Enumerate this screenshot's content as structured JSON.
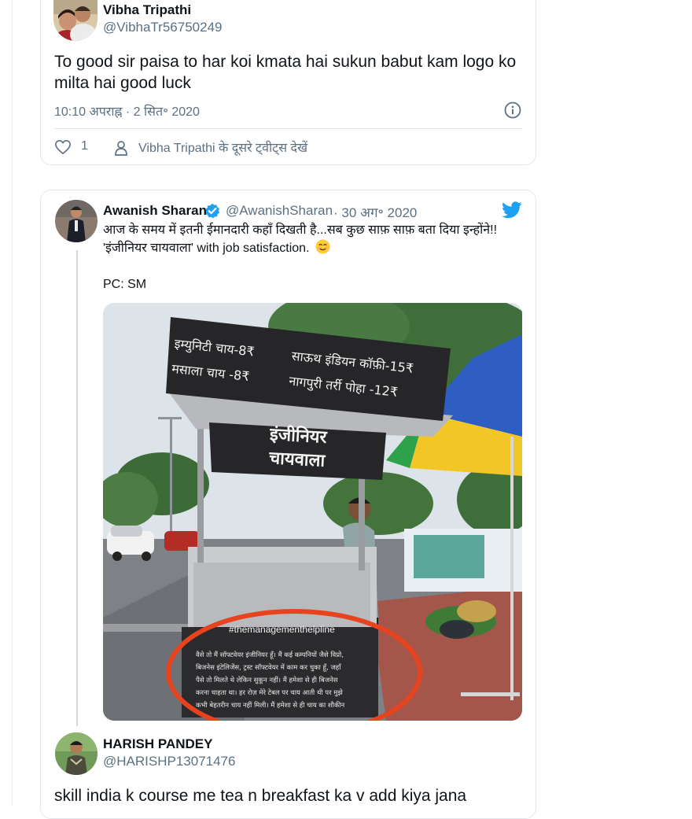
{
  "tweet1": {
    "name": "Vibha Tripathi",
    "handle": "@VibhaTr56750249",
    "text": "To good sir paisa to har koi kmata hai sukun babut kam logo ko milta hai good luck",
    "timestamp": "10:10 अपराह्न · 2 सित॰ 2020",
    "like_count": "1",
    "more_tweets_link": "Vibha Tripathi के दूसरे ट्वीट्स देखें",
    "icons": [
      "info-icon",
      "heart-icon",
      "person-icon"
    ]
  },
  "tweet2": {
    "name": "Awanish Sharan",
    "handle": "@AwanishSharan",
    "date": "· 30 अग॰ 2020",
    "line1": "आज के समय में इतनी ईमानदारी कहाँ दिखती है...सब कुछ साफ़ साफ़ बता दिया इन्होंने!!",
    "line2": "'इंजीनियर चायवाला' with job satisfaction.",
    "credit": "PC: SM",
    "icons": [
      "verified-badge-icon",
      "twitter-bird-icon",
      "smile-emoji-icon"
    ],
    "photo": {
      "menu_line1_left": "इम्युनिटी चाय-8₹",
      "menu_line1_right": "साऊथ इंडियन कॉफ़ी-15₹",
      "menu_line2_left": "मसाला चाय -8₹",
      "menu_line2_right": "नागपुरी तर्री पोहा -12₹",
      "stall_name_line1": "इंजीनियर",
      "stall_name_line2": "चायवाला",
      "hashtag": "#themanagementhelpline",
      "note_lines": [
        "वैसे तो मैं सॉफ्टवेयर इंजीनियर हूँ। मैं कई कम्पनियों जैसे विप्रो,",
        "बिजनेस इंटेलिजेंस, ट्रस्ट सॉफ्टवेयर में काम कर चुका हूँ, जहाँ",
        "पैसे तो मिलते थे लेकिन सुकून नहीं। मैं हमेशा से ही बिजनेस",
        "करना चाहता था। हर रोज़ मेरे टेबल पर चाय आती थी पर मुझे",
        "कभी बेहतरीन चाय नहीं मिली। मैं हमेशा से ही चाय का शौकीन"
      ]
    }
  },
  "tweet3": {
    "name": "HARISH PANDEY",
    "handle": "@HARISHP13071476",
    "text": "skill india k course me tea n breakfast ka v add kiya jana"
  },
  "colors": {
    "text_primary": "#0f1419",
    "text_secondary": "#5b7083",
    "border": "#e1e8ed",
    "twitter_blue": "#1da1f2",
    "board_dark": "#262629",
    "annotation_red": "#e8431f"
  }
}
